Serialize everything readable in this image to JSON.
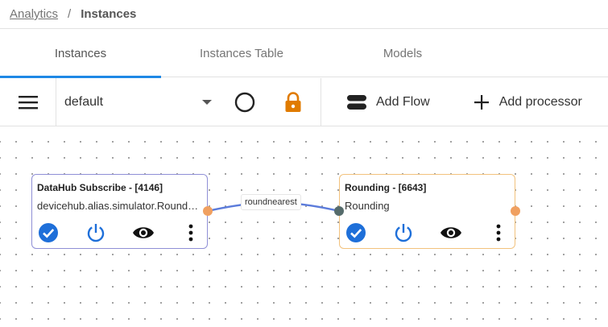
{
  "breadcrumb": {
    "link": "Analytics",
    "separator": "/",
    "current": "Instances"
  },
  "tabs": [
    {
      "label": "Instances"
    },
    {
      "label": "Instances Table"
    },
    {
      "label": "Models"
    }
  ],
  "toolbar": {
    "select_value": "default",
    "add_flow_label": "Add Flow",
    "add_processor_label": "Add processor"
  },
  "nodes": [
    {
      "title": "DataHub Subscribe - [4146]",
      "subtitle": "devicehub.alias.simulator.RoundNearest",
      "border_color": "#8f8fd6"
    },
    {
      "title": "Rounding - [6643]",
      "subtitle": "Rounding",
      "border_color": "#f2c27d"
    }
  ],
  "edge": {
    "label": "roundnearest",
    "color": "#5c7cdb"
  },
  "colors": {
    "accent": "#1e88e5",
    "lock": "#e07b00",
    "handle_out": "#f0a060",
    "handle_in": "#556b6b"
  }
}
